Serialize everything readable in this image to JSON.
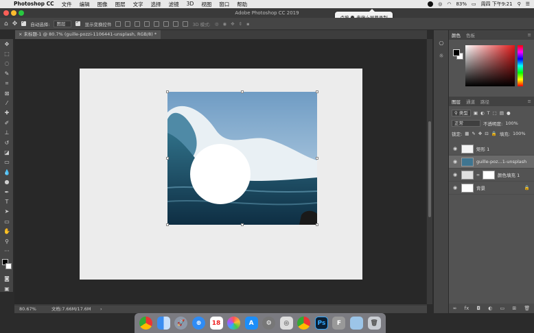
{
  "menubar": {
    "items": [
      "Photoshop CC",
      "文件",
      "编辑",
      "图像",
      "图层",
      "文字",
      "选择",
      "滤镜",
      "3D",
      "视图",
      "窗口",
      "帮助"
    ],
    "battery": "83%",
    "clock": "周四 下午9:21"
  },
  "recording_tip": {
    "prefix": "点按",
    "suffix": "来停止屏幕录制"
  },
  "window_title": "Adobe Photoshop CC 2019",
  "options": {
    "auto_select": "自动选择:",
    "layer_select": "图层",
    "show_transform": "显示变换控件",
    "mode_3d": "3D 模式:"
  },
  "doc_tab": "未标题-1 @ 80.7% (guille-pozzi-1106441-unsplash, RGB/8) *",
  "status": {
    "zoom": "80.67%",
    "doc_size": "文档:7.66M/17.6M"
  },
  "panels": {
    "color_tabs": [
      "颜色",
      "色板"
    ],
    "layer_tabs": [
      "图层",
      "通道",
      "路径"
    ],
    "kind": "类型",
    "blend_mode": "正常",
    "opacity_label": "不透明度:",
    "opacity": "100%",
    "lock_label": "锁定:",
    "fill_label": "填充:",
    "fill": "100%"
  },
  "layers": [
    {
      "name": "矩形 1",
      "active": false
    },
    {
      "name": "guille-poz...1-unsplash",
      "active": true
    },
    {
      "name": "颜色填充 1",
      "active": false
    },
    {
      "name": "背景",
      "active": false
    }
  ],
  "colors": {
    "bg": "#2b2b2b",
    "panel": "#535353",
    "accent": "#1473e6"
  }
}
